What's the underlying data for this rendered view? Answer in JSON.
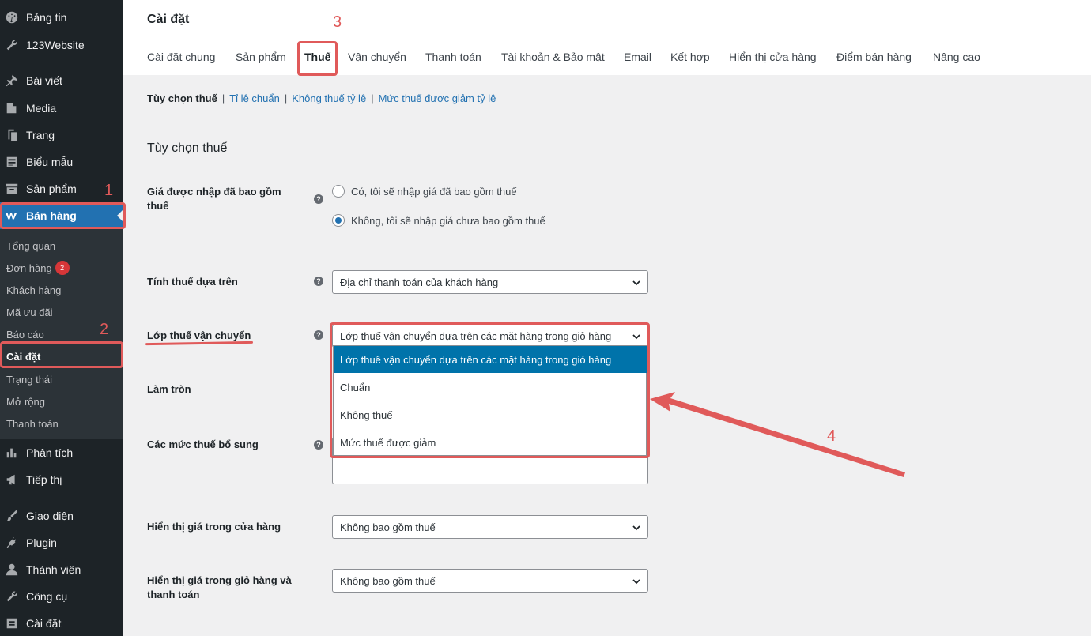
{
  "sidebar": {
    "items": [
      {
        "label": "Bảng tin",
        "icon": "dashboard-icon"
      },
      {
        "label": "123Website",
        "icon": "wrench-icon"
      },
      {
        "label": "Bài viết",
        "icon": "pin-icon"
      },
      {
        "label": "Media",
        "icon": "media-icon"
      },
      {
        "label": "Trang",
        "icon": "page-icon"
      },
      {
        "label": "Biểu mẫu",
        "icon": "form-icon"
      },
      {
        "label": "Sản phẩm",
        "icon": "archive-icon"
      },
      {
        "label": "Bán hàng",
        "icon": "woo-icon"
      },
      {
        "label": "Phân tích",
        "icon": "chart-icon"
      },
      {
        "label": "Tiếp thị",
        "icon": "megaphone-icon"
      },
      {
        "label": "Giao diện",
        "icon": "brush-icon"
      },
      {
        "label": "Plugin",
        "icon": "plug-icon"
      },
      {
        "label": "Thành viên",
        "icon": "user-icon"
      },
      {
        "label": "Công cụ",
        "icon": "tools-icon"
      },
      {
        "label": "Cài đặt",
        "icon": "settings-icon"
      }
    ],
    "submenu": [
      {
        "label": "Tổng quan"
      },
      {
        "label": "Đơn hàng",
        "badge": "2"
      },
      {
        "label": "Khách hàng"
      },
      {
        "label": "Mã ưu đãi"
      },
      {
        "label": "Báo cáo"
      },
      {
        "label": "Cài đặt"
      },
      {
        "label": "Trạng thái"
      },
      {
        "label": "Mở rộng"
      },
      {
        "label": "Thanh toán"
      }
    ]
  },
  "header": {
    "title": "Cài đặt",
    "tabs": [
      "Cài đặt chung",
      "Sản phẩm",
      "Thuế",
      "Vận chuyển",
      "Thanh toán",
      "Tài khoản & Bảo mật",
      "Email",
      "Kết hợp",
      "Hiển thị cửa hàng",
      "Điểm bán hàng",
      "Nâng cao"
    ],
    "active_tab": "Thuế"
  },
  "subsubsub": [
    "Tùy chọn thuế",
    "Tỉ lệ chuẩn",
    "Không thuế tỷ lệ",
    "Mức thuế được giảm tỷ lệ"
  ],
  "section_title": "Tùy chọn thuế",
  "form": {
    "prices_incl_tax": {
      "label": "Giá được nhập đã bao gồm thuế",
      "options": [
        "Có, tôi sẽ nhập giá đã bao gồm thuế",
        "Không, tôi sẽ nhập giá chưa bao gồm thuế"
      ],
      "selected_index": 1
    },
    "tax_based_on": {
      "label": "Tính thuế dựa trên",
      "value": "Địa chỉ thanh toán của khách hàng"
    },
    "shipping_tax_class": {
      "label": "Lớp thuế vận chuyển",
      "value": "Lớp thuế vận chuyển dựa trên các mặt hàng trong giỏ hàng",
      "options": [
        "Lớp thuế vận chuyển dựa trên các mặt hàng trong giỏ hàng",
        "Chuẩn",
        "Không thuế",
        "Mức thuế được giảm"
      ]
    },
    "rounding": {
      "label": "Làm tròn"
    },
    "additional_classes": {
      "label": "Các mức thuế bổ sung",
      "value": "Mức thuế được giảm"
    },
    "display_shop": {
      "label": "Hiển thị giá trong cửa hàng",
      "value": "Không bao gồm thuế"
    },
    "display_cart": {
      "label": "Hiển thị giá trong giỏ hàng và thanh toán",
      "value": "Không bao gồm thuế"
    }
  },
  "help_symbol": "?",
  "annotations": [
    "1",
    "2",
    "3",
    "4"
  ],
  "colors": {
    "sidebar_bg": "#1d2327",
    "accent": "#2271b1",
    "highlight": "#0073aa",
    "annotation": "#e05a5a"
  }
}
